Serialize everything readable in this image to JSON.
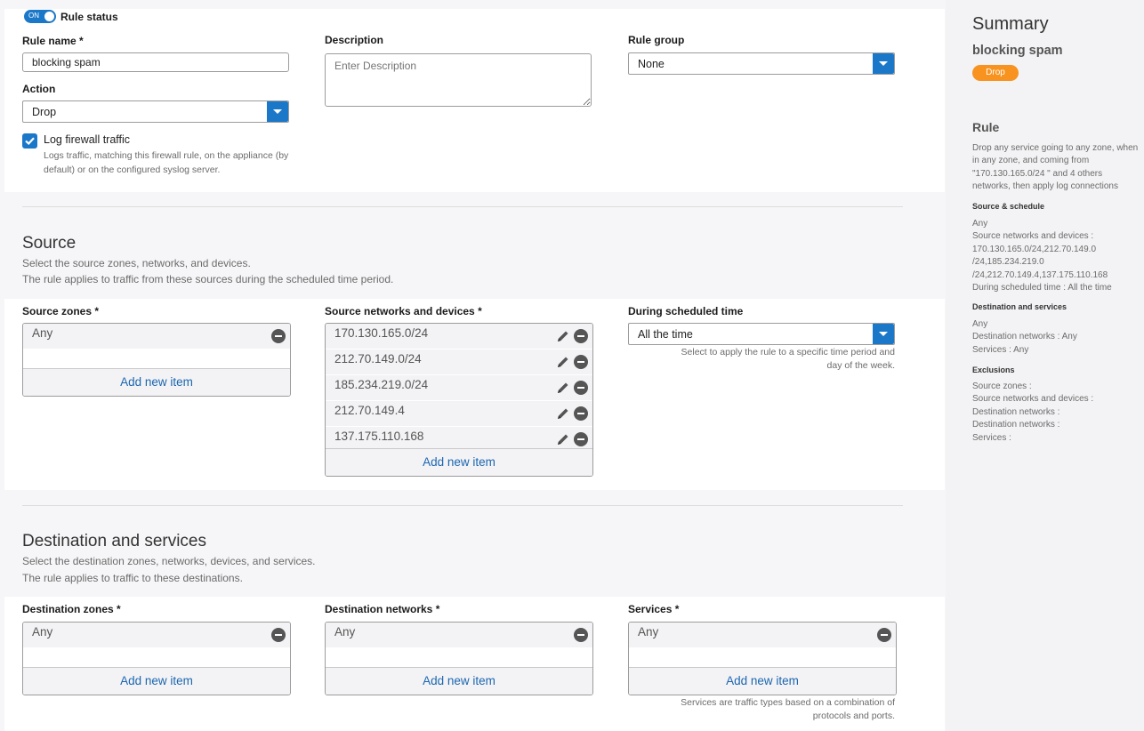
{
  "rule_status": {
    "toggle_label": "ON",
    "label": "Rule status"
  },
  "rule_name": {
    "label": "Rule name *",
    "value": "blocking spam"
  },
  "description": {
    "label": "Description",
    "placeholder": "Enter Description"
  },
  "rule_group": {
    "label": "Rule group",
    "value": "None"
  },
  "action": {
    "label": "Action",
    "value": "Drop"
  },
  "log_traffic": {
    "label": "Log firewall traffic",
    "checked": true,
    "help_line1": "Logs traffic, matching this firewall rule, on the appliance (by",
    "help_line2": "default) or on the configured syslog server."
  },
  "source": {
    "title": "Source",
    "desc1": "Select the source zones, networks, and devices.",
    "desc2": "The rule applies to traffic from these sources during the scheduled time period.",
    "zones": {
      "label": "Source zones *",
      "items": [
        "Any"
      ],
      "add_label": "Add new item"
    },
    "networks": {
      "label": "Source networks and devices *",
      "items": [
        "170.130.165.0/24",
        "212.70.149.0/24",
        "185.234.219.0/24",
        "212.70.149.4",
        "137.175.110.168"
      ],
      "add_label": "Add new item"
    },
    "schedule": {
      "label": "During scheduled time",
      "value": "All the time",
      "hint1": "Select to apply the rule to a specific time period and",
      "hint2": "day of the week."
    }
  },
  "destination": {
    "title": "Destination and services",
    "desc1": "Select the destination zones, networks, devices, and services.",
    "desc2": "The rule applies to traffic to these destinations.",
    "zones": {
      "label": "Destination zones *",
      "items": [
        "Any"
      ],
      "add_label": "Add new item"
    },
    "networks": {
      "label": "Destination networks *",
      "items": [
        "Any"
      ],
      "add_label": "Add new item"
    },
    "services": {
      "label": "Services *",
      "items": [
        "Any"
      ],
      "add_label": "Add new item",
      "hint1": "Services are traffic types based on a combination of",
      "hint2": "protocols and ports."
    }
  },
  "summary": {
    "title": "Summary",
    "rule_name": "blocking spam",
    "action_badge": "Drop",
    "rule_heading": "Rule",
    "rule_desc": [
      "Drop any service going to any zone, when",
      "in any zone, and coming from",
      "\"170.130.165.0/24 \" and 4 others",
      "networks, then apply log connections"
    ],
    "source_heading": "Source & schedule",
    "source_lines": [
      "Any",
      "Source networks and devices :",
      "170.130.165.0/24,212.70.149.0",
      "/24,185.234.219.0",
      "/24,212.70.149.4,137.175.110.168",
      "During scheduled time : All the time"
    ],
    "dest_heading": "Destination and services",
    "dest_lines": [
      "Any",
      "Destination networks : Any",
      "Services : Any"
    ],
    "excl_heading": "Exclusions",
    "excl_lines": [
      "Source zones :",
      "Source networks and devices :",
      "Destination networks :",
      "Destination networks :",
      "Services :"
    ]
  },
  "colors": {
    "accent": "#1b78c9",
    "link": "#1b66b0",
    "badge": "#f7931e"
  }
}
